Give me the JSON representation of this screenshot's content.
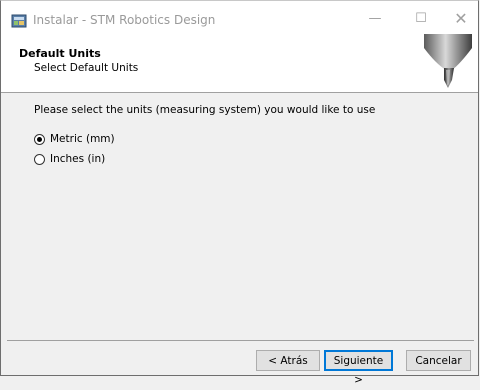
{
  "window": {
    "title": "Instalar - STM Robotics Design",
    "minimize": "—",
    "maximize": "☐",
    "close": "✕"
  },
  "header": {
    "title": "Default Units",
    "subtitle": "Select Default Units"
  },
  "content": {
    "prompt": "Please select the units (measuring system) you would like to use",
    "options": [
      {
        "label": "Metric (mm)",
        "selected": true
      },
      {
        "label": "Inches (in)",
        "selected": false
      }
    ]
  },
  "buttons": {
    "back": "< Atrás",
    "next": "Siguiente >",
    "cancel": "Cancelar"
  },
  "colors": {
    "focus_border": "#0078d7"
  }
}
